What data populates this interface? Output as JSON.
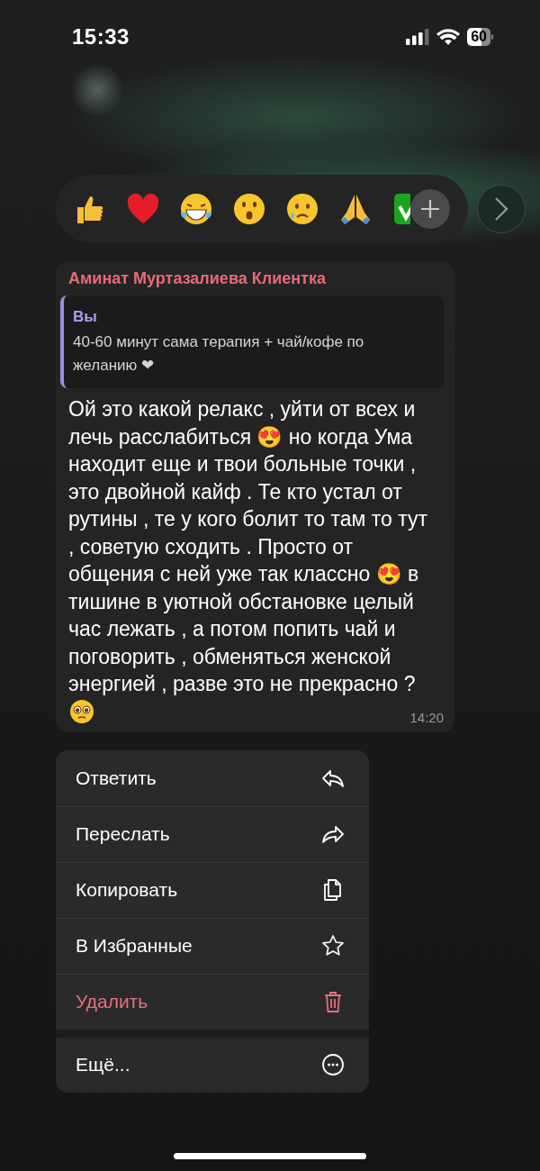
{
  "status_bar": {
    "time": "15:33",
    "battery": "60"
  },
  "message": {
    "sender": "Аминат Муртазалиева Клиентка",
    "reply": {
      "author": "Вы",
      "text": "40-60 минут сама терапия + чай/кофе по желанию ❤"
    },
    "text": "Ой это какой релакс , уйти от всех и лечь расслабиться 😍 но когда Ума находит еще и твои больные точки , это двойной кайф . Те кто устал от рутины , те у кого болит то там то тут , советую сходить . Просто от общения с ней уже так классно 😍 в тишине в уютной обстановке целый час лежать , а потом попить чай и поговорить , обменяться женской энергией , разве это  не прекрасно ?",
    "time": "14:20"
  },
  "menu": [
    {
      "label": "Ответить",
      "kind": "reply",
      "destructive": false,
      "separated": false
    },
    {
      "label": "Переслать",
      "kind": "forward",
      "destructive": false,
      "separated": false
    },
    {
      "label": "Копировать",
      "kind": "copy",
      "destructive": false,
      "separated": false
    },
    {
      "label": "В Избранные",
      "kind": "favorite",
      "destructive": false,
      "separated": false
    },
    {
      "label": "Удалить",
      "kind": "delete",
      "destructive": true,
      "separated": false
    },
    {
      "label": "Ещё...",
      "kind": "more",
      "destructive": false,
      "separated": true
    }
  ]
}
